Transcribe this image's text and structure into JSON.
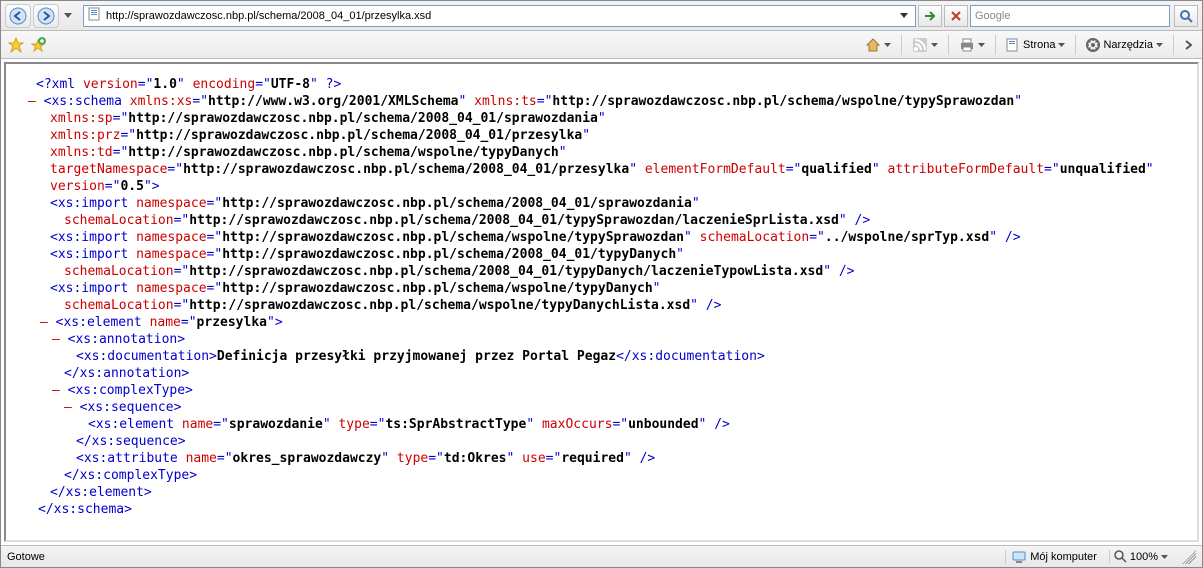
{
  "nav": {
    "url": "http://sprawozdawczosc.nbp.pl/schema/2008_04_01/przesylka.xsd",
    "search_placeholder": "Google"
  },
  "toolbar": {
    "page_label": "Strona",
    "tools_label": "Narzędzia"
  },
  "xml": {
    "declaration": {
      "version": "1.0",
      "encoding": "UTF-8"
    },
    "schema": {
      "xmlns_xs": "http://www.w3.org/2001/XMLSchema",
      "xmlns_ts": "http://sprawozdawczosc.nbp.pl/schema/wspolne/typySprawozdan",
      "xmlns_sp": "http://sprawozdawczosc.nbp.pl/schema/2008_04_01/sprawozdania",
      "xmlns_prz": "http://sprawozdawczosc.nbp.pl/schema/2008_04_01/przesylka",
      "xmlns_td": "http://sprawozdawczosc.nbp.pl/schema/wspolne/typyDanych",
      "targetNamespace": "http://sprawozdawczosc.nbp.pl/schema/2008_04_01/przesylka",
      "elementFormDefault": "qualified",
      "attributeFormDefault": "unqualified",
      "version": "0.5"
    },
    "imports": [
      {
        "namespace": "http://sprawozdawczosc.nbp.pl/schema/2008_04_01/sprawozdania",
        "schemaLocation": "http://sprawozdawczosc.nbp.pl/schema/2008_04_01/typySprawozdan/laczenieSprLista.xsd"
      },
      {
        "namespace": "http://sprawozdawczosc.nbp.pl/schema/wspolne/typySprawozdan",
        "schemaLocation": "../wspolne/sprTyp.xsd"
      },
      {
        "namespace": "http://sprawozdawczosc.nbp.pl/schema/2008_04_01/typyDanych",
        "schemaLocation": "http://sprawozdawczosc.nbp.pl/schema/2008_04_01/typyDanych/laczenieTypowLista.xsd"
      },
      {
        "namespace": "http://sprawozdawczosc.nbp.pl/schema/wspolne/typyDanych",
        "schemaLocation": "http://sprawozdawczosc.nbp.pl/schema/wspolne/typyDanychLista.xsd"
      }
    ],
    "element": {
      "name": "przesylka",
      "documentation": "Definicja przesyłki przyjmowanej przez Portal Pegaz",
      "child_element": {
        "name": "sprawozdanie",
        "type": "ts:SprAbstractType",
        "maxOccurs": "unbounded"
      },
      "attribute": {
        "name": "okres_sprawozdawczy",
        "type": "td:Okres",
        "use": "required"
      }
    }
  },
  "status": {
    "text": "Gotowe",
    "zone": "Mój komputer",
    "zoom": "100%"
  }
}
